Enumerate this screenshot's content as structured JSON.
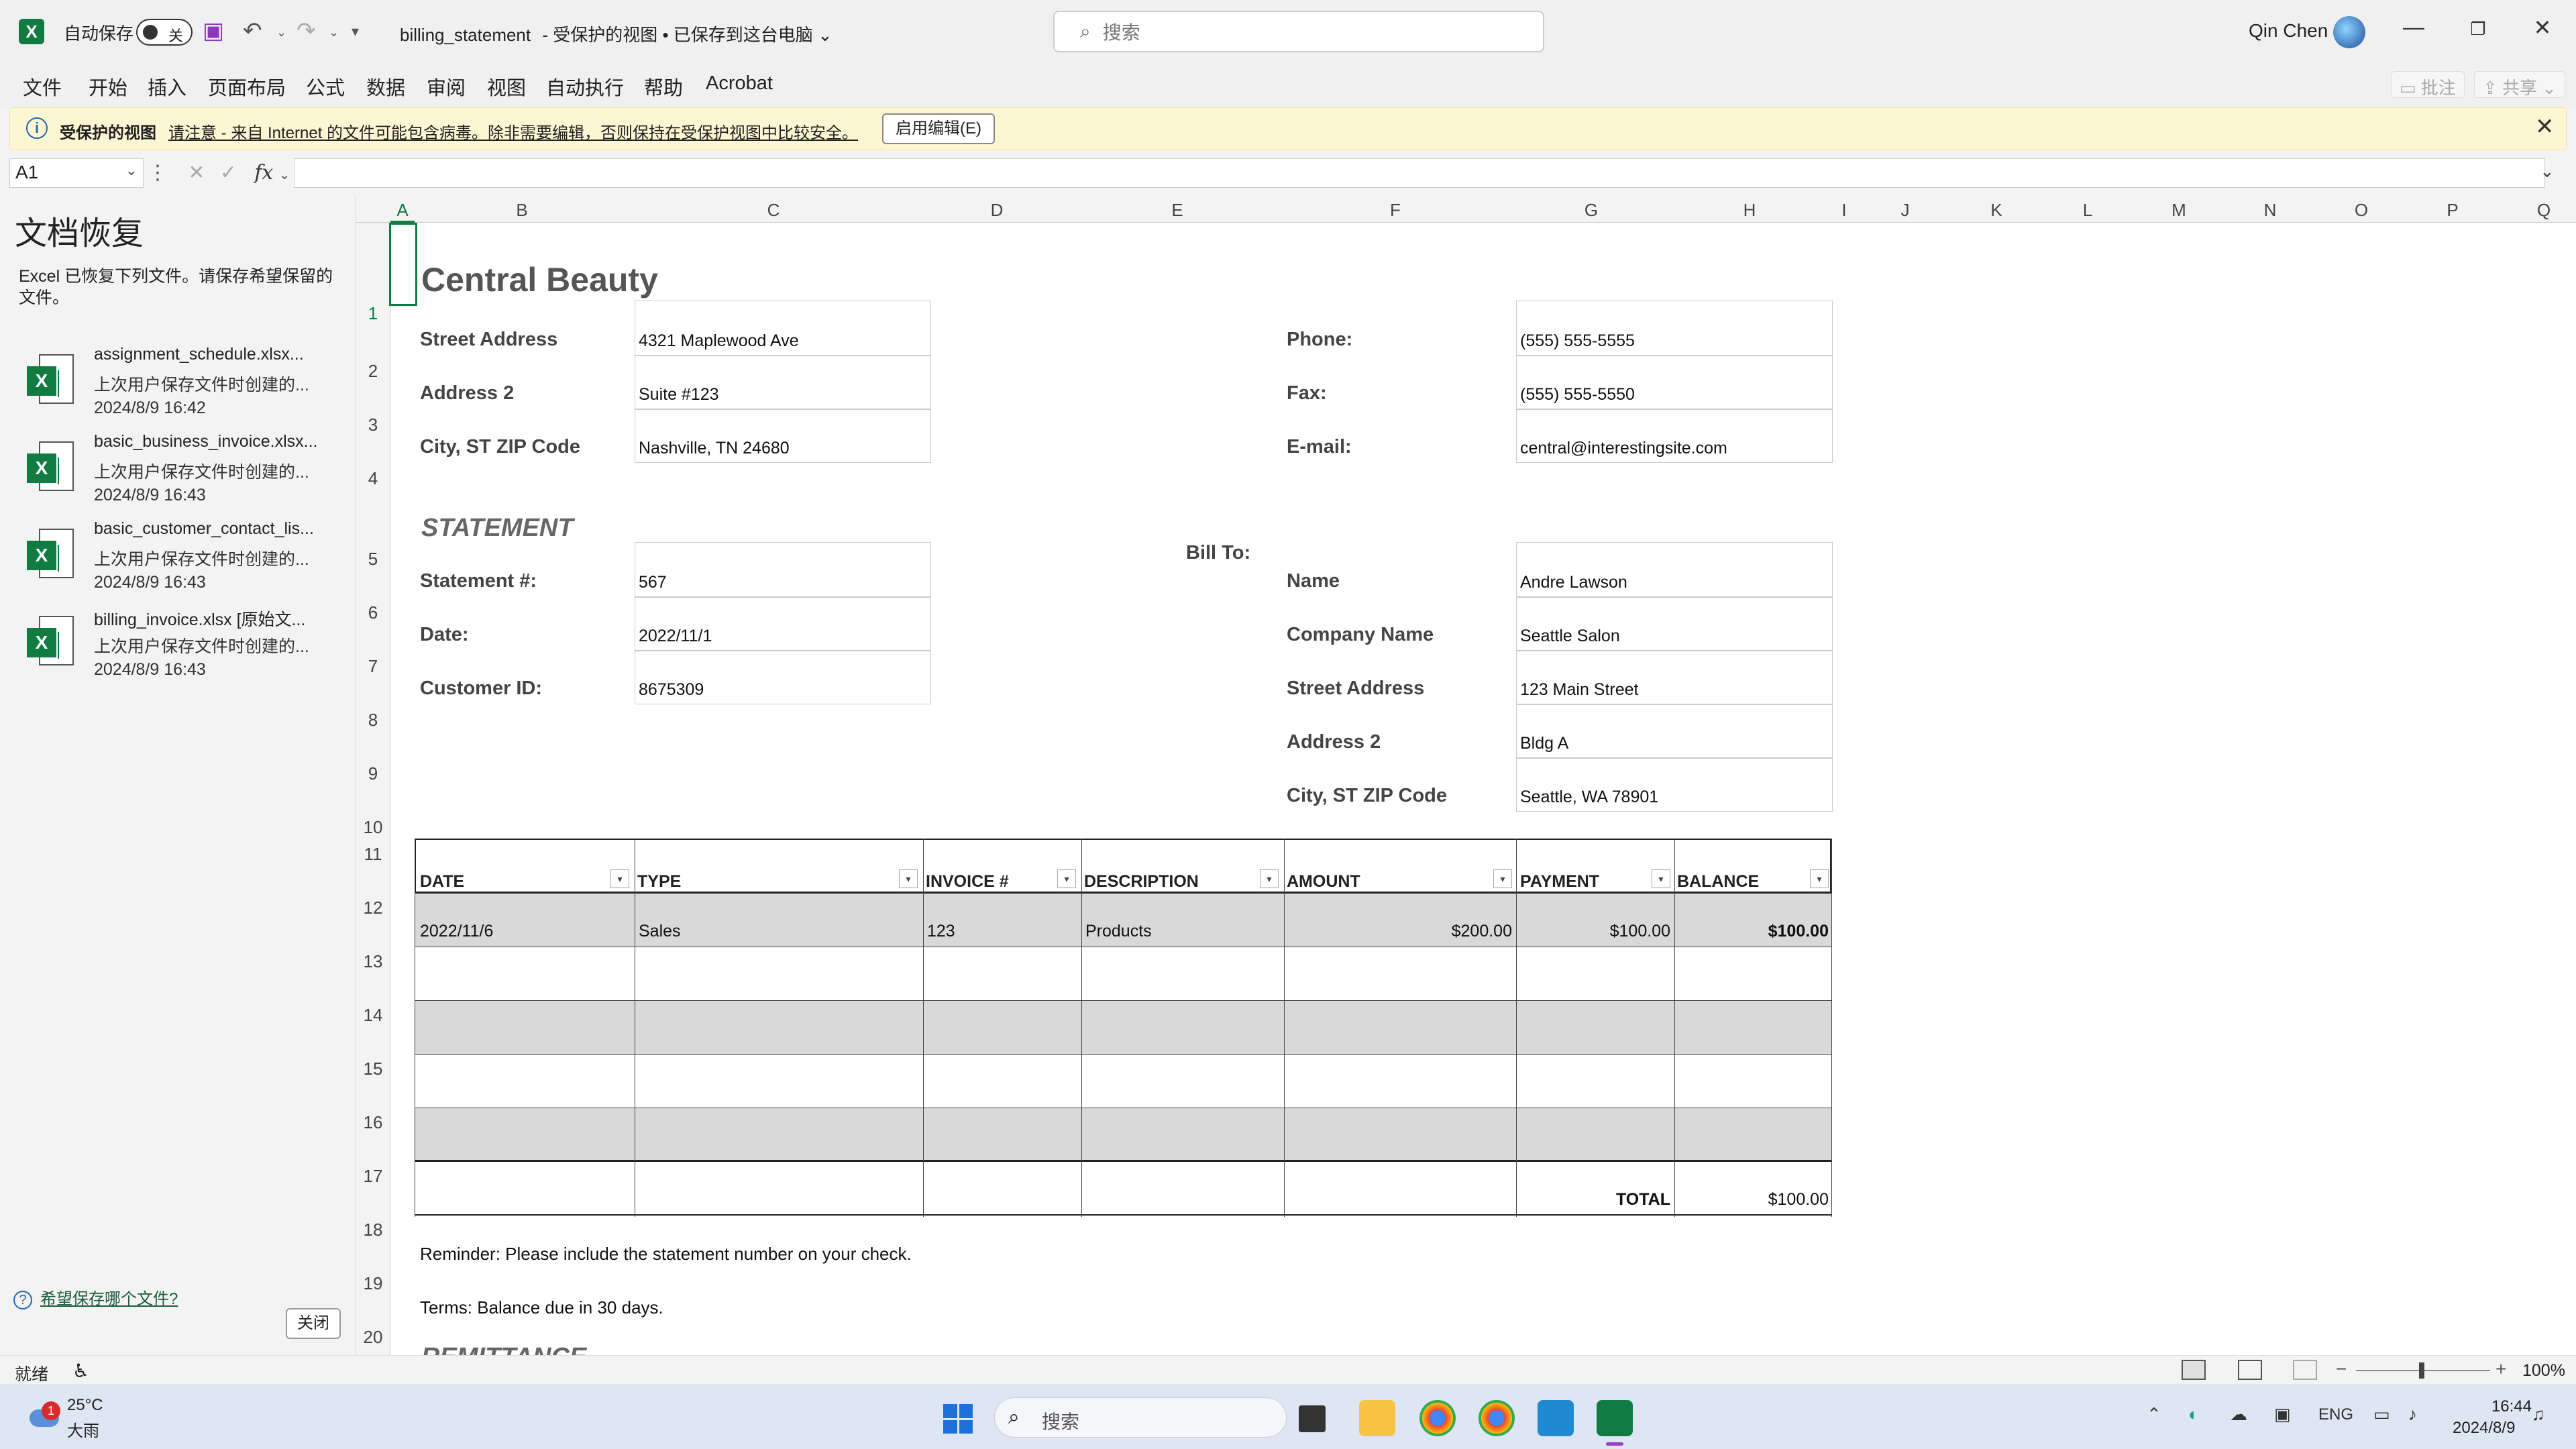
{
  "titlebar": {
    "autosave_label": "自动保存",
    "autosave_state": "关",
    "doc_name": "billing_statement",
    "doc_status": "-  受保护的视图 • 已保存到这台电脑",
    "search_placeholder": "搜索",
    "user_name": "Qin Chen"
  },
  "menu": [
    "文件",
    "开始",
    "插入",
    "页面布局",
    "公式",
    "数据",
    "审阅",
    "视图",
    "自动执行",
    "帮助",
    "Acrobat"
  ],
  "menu_right": {
    "comments": "批注",
    "share": "共享"
  },
  "banner": {
    "title": "受保护的视图",
    "message": "请注意 - 来自 Internet 的文件可能包含病毒。除非需要编辑，否则保持在受保护视图中比较安全。",
    "enable_button": "启用编辑(E)"
  },
  "formula_bar": {
    "name_box": "A1",
    "fx": "fx",
    "value": ""
  },
  "recovery": {
    "title": "文档恢复",
    "description": "Excel 已恢复下列文件。请保存希望保留的文件。",
    "files": [
      {
        "name": "assignment_schedule.xlsx...",
        "desc": "上次用户保存文件时创建的...",
        "time": "2024/8/9 16:42"
      },
      {
        "name": "basic_business_invoice.xlsx...",
        "desc": "上次用户保存文件时创建的...",
        "time": "2024/8/9 16:43"
      },
      {
        "name": "basic_customer_contact_lis...",
        "desc": "上次用户保存文件时创建的...",
        "time": "2024/8/9 16:43"
      },
      {
        "name": "billing_invoice.xlsx  [原始文...",
        "desc": "上次用户保存文件时创建的...",
        "time": "2024/8/9 16:43"
      }
    ],
    "help_link": "希望保存哪个文件?",
    "close_button": "关闭"
  },
  "columns": [
    "A",
    "B",
    "C",
    "D",
    "E",
    "F",
    "G",
    "H",
    "I",
    "J",
    "K",
    "L",
    "M",
    "N",
    "O",
    "P",
    "Q"
  ],
  "rows": [
    "1",
    "2",
    "3",
    "4",
    "5",
    "6",
    "7",
    "8",
    "9",
    "10",
    "11",
    "12",
    "13",
    "14",
    "15",
    "16",
    "17",
    "18",
    "19",
    "20"
  ],
  "sheet": {
    "company": "Central Beauty",
    "street_label": "Street Address",
    "street": "4321 Maplewood Ave",
    "addr2_label": "Address 2",
    "addr2": "Suite #123",
    "city_label": "City, ST  ZIP Code",
    "city": "Nashville, TN 24680",
    "phone_label": "Phone:",
    "phone": "(555) 555-5555",
    "fax_label": "Fax:",
    "fax": "(555) 555-5550",
    "email_label": "E-mail:",
    "email": "central@interestingsite.com",
    "statement_title": "STATEMENT",
    "stmt_no_label": "Statement #:",
    "stmt_no": "567",
    "date_label": "Date:",
    "date": "2022/11/1",
    "cust_label": "Customer ID:",
    "cust": "8675309",
    "bill_to": "Bill To:",
    "bt_name_label": "Name",
    "bt_name": "Andre Lawson",
    "bt_company_label": "Company Name",
    "bt_company": "Seattle Salon",
    "bt_street_label": "Street Address",
    "bt_street": "123 Main Street",
    "bt_addr2_label": "Address 2",
    "bt_addr2": "Bldg A",
    "bt_city_label": "City, ST  ZIP Code",
    "bt_city": "Seattle, WA 78901",
    "table_headers": [
      "DATE",
      "TYPE",
      "INVOICE #",
      "DESCRIPTION",
      "AMOUNT",
      "PAYMENT",
      "BALANCE"
    ],
    "row13": {
      "date": "2022/11/6",
      "type": "Sales",
      "invoice": "123",
      "description": "Products",
      "amount": "$200.00",
      "payment": "$100.00",
      "balance": "$100.00"
    },
    "total_label": "TOTAL",
    "total": "$100.00",
    "reminder": "Reminder: Please include the statement number on your check.",
    "terms": "Terms: Balance due in 30 days.",
    "remittance": "REMITTANCE"
  },
  "statusbar": {
    "ready": "就绪",
    "zoom": "100%"
  },
  "taskbar": {
    "temp": "25°C",
    "weather": "大雨",
    "weather_badge": "1",
    "search_placeholder": "搜索",
    "lang": "ENG",
    "time": "16:44",
    "date": "2024/8/9"
  },
  "colors": {
    "excel_green": "#107c41",
    "banner_bg": "#fdf6d3",
    "shade": "#d9d9d9"
  }
}
